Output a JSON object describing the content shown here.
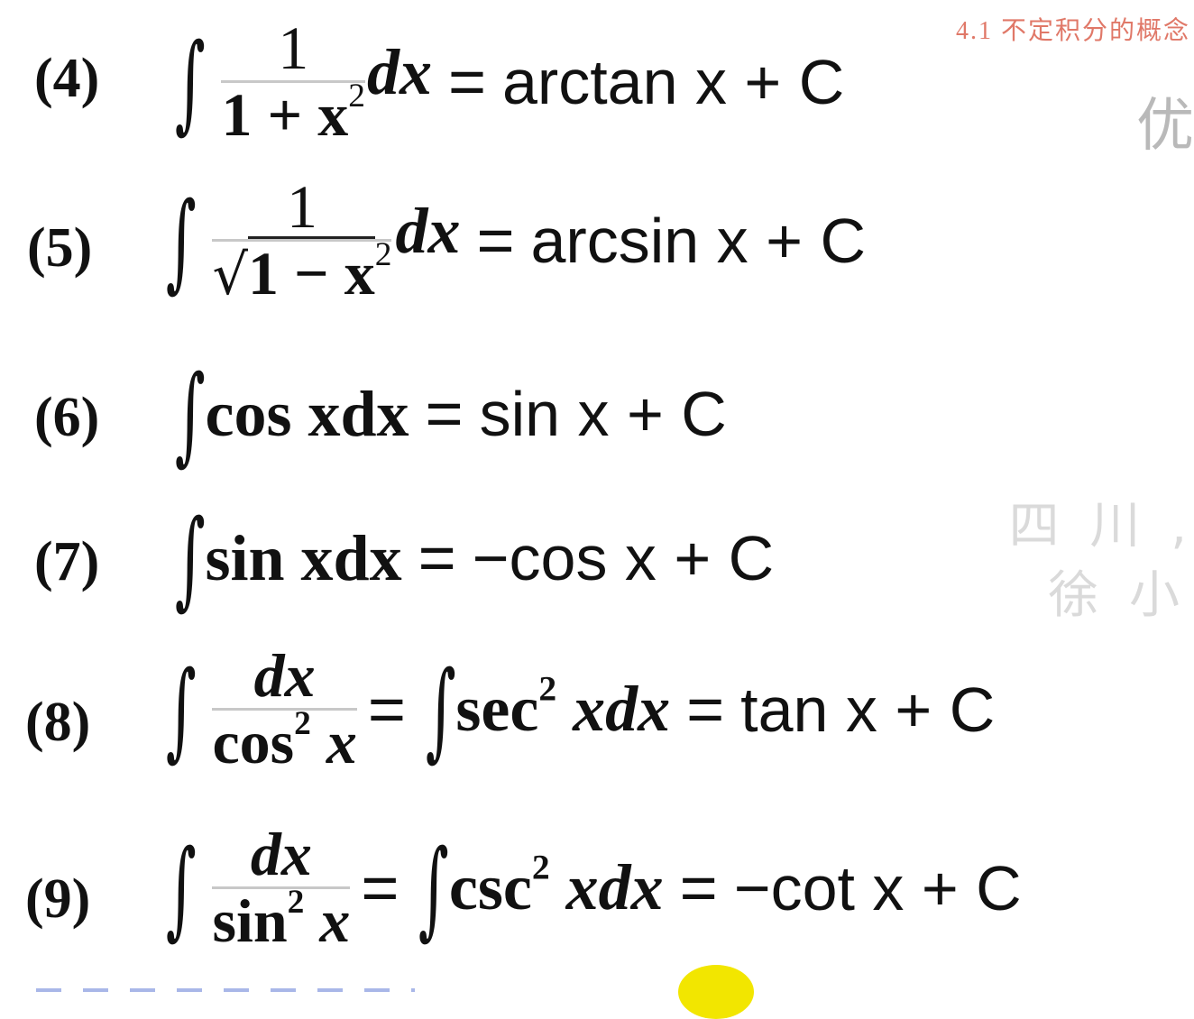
{
  "header": "4.1 不定积分的概念",
  "watermarks": {
    "w1": "优",
    "w2": "四 川 ,",
    "w3": "徐 小"
  },
  "formulas": [
    {
      "number": "(4)",
      "integral": "∫",
      "numerator": "1",
      "denominator": "1 + x",
      "denominator_sup": "2",
      "dx": "dx",
      "eq": "=",
      "result": "arctan x + C"
    },
    {
      "number": "(5)",
      "integral": "∫",
      "numerator": "1",
      "sqrt": "√",
      "denominator": "1 − x",
      "denominator_sup": "2",
      "dx": "dx",
      "eq": "=",
      "result": "arcsin x + C"
    },
    {
      "number": "(6)",
      "integral": "∫",
      "integrand": "cos xdx",
      "eq": "=",
      "result": "sin x + C"
    },
    {
      "number": "(7)",
      "integral": "∫",
      "integrand": "sin xdx",
      "eq": "=",
      "result": "−cos x + C"
    },
    {
      "number": "(8)",
      "integral": "∫",
      "numerator": "dx",
      "denominator": "cos",
      "denominator_sup": "2",
      "denominator_tail": " x",
      "eq": "=",
      "integral2": "∫",
      "integrand2": "sec",
      "integrand2_sup": "2",
      "integrand2_tail": " xdx",
      "eq2": "=",
      "result": "tan x + C"
    },
    {
      "number": "(9)",
      "integral": "∫",
      "numerator": "dx",
      "denominator": "sin",
      "denominator_sup": "2",
      "denominator_tail": " x",
      "eq": "=",
      "integral2": "∫",
      "integrand2": "csc",
      "integrand2_sup": "2",
      "integrand2_tail": " xdx",
      "eq2": "=",
      "result": "−cot x + C"
    }
  ]
}
